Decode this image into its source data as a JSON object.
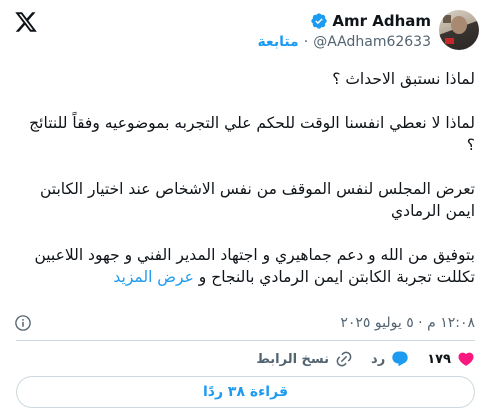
{
  "header": {
    "name": "Amr Adham",
    "handle": "@AAdham62633",
    "follow_label": "متابعة",
    "dot": "·"
  },
  "tweet": {
    "lines": [
      "لماذا نستبق الاحداث ؟",
      "لماذا لا نعطي انفسنا الوقت للحكم علي التجربه بموضوعيه وفقاً للنتائج ؟",
      "تعرض المجلس لنفس الموقف من نفس الاشخاص  عند اختيار الكابتن ايمن الرمادي",
      "بتوفيق من الله و دعم جماهيري و اجتهاد المدير الفني و جهود اللاعبين تكللت تجربة الكابتن ايمن الرمادي بالنجاح و"
    ],
    "show_more": "عرض المزيد",
    "timestamp": "١٢:٠٨ م · ٥ يوليو ٢٠٢٥"
  },
  "actions": {
    "likes": "١٧٩",
    "reply_label": "رد",
    "copy_link_label": "نسخ الرابط"
  },
  "reply_button": {
    "label": "قراءة ٣٨ ردًا"
  },
  "colors": {
    "accent": "#1d9bf0",
    "like": "#f91880",
    "muted": "#536471",
    "text": "#0f1419"
  }
}
